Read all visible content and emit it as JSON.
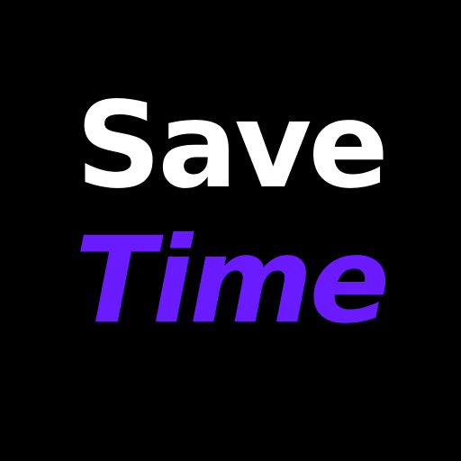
{
  "logo": {
    "line1": "Save",
    "line2": "Time",
    "colors": {
      "background": "#000000",
      "line1": "#ffffff",
      "line2": "#6a1bff"
    }
  }
}
